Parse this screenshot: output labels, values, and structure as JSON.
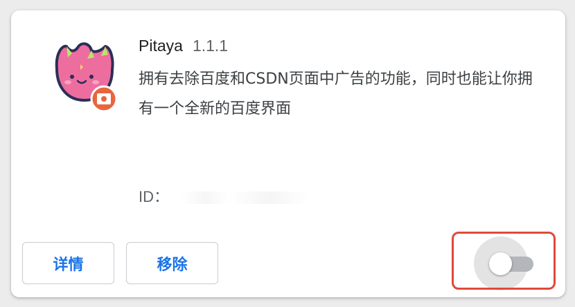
{
  "extension": {
    "name": "Pitaya",
    "version": "1.1.1",
    "description": "拥有去除百度和CSDN页面中广告的功能，同时也能让你拥有一个全新的百度界面",
    "id_label": "ID："
  },
  "actions": {
    "details_label": "详情",
    "remove_label": "移除"
  },
  "toggle": {
    "enabled": false
  },
  "colors": {
    "accent": "#1a73e8",
    "highlight": "#e0483b",
    "logo_pink": "#ee6d9f",
    "logo_orange": "#e8663c"
  }
}
